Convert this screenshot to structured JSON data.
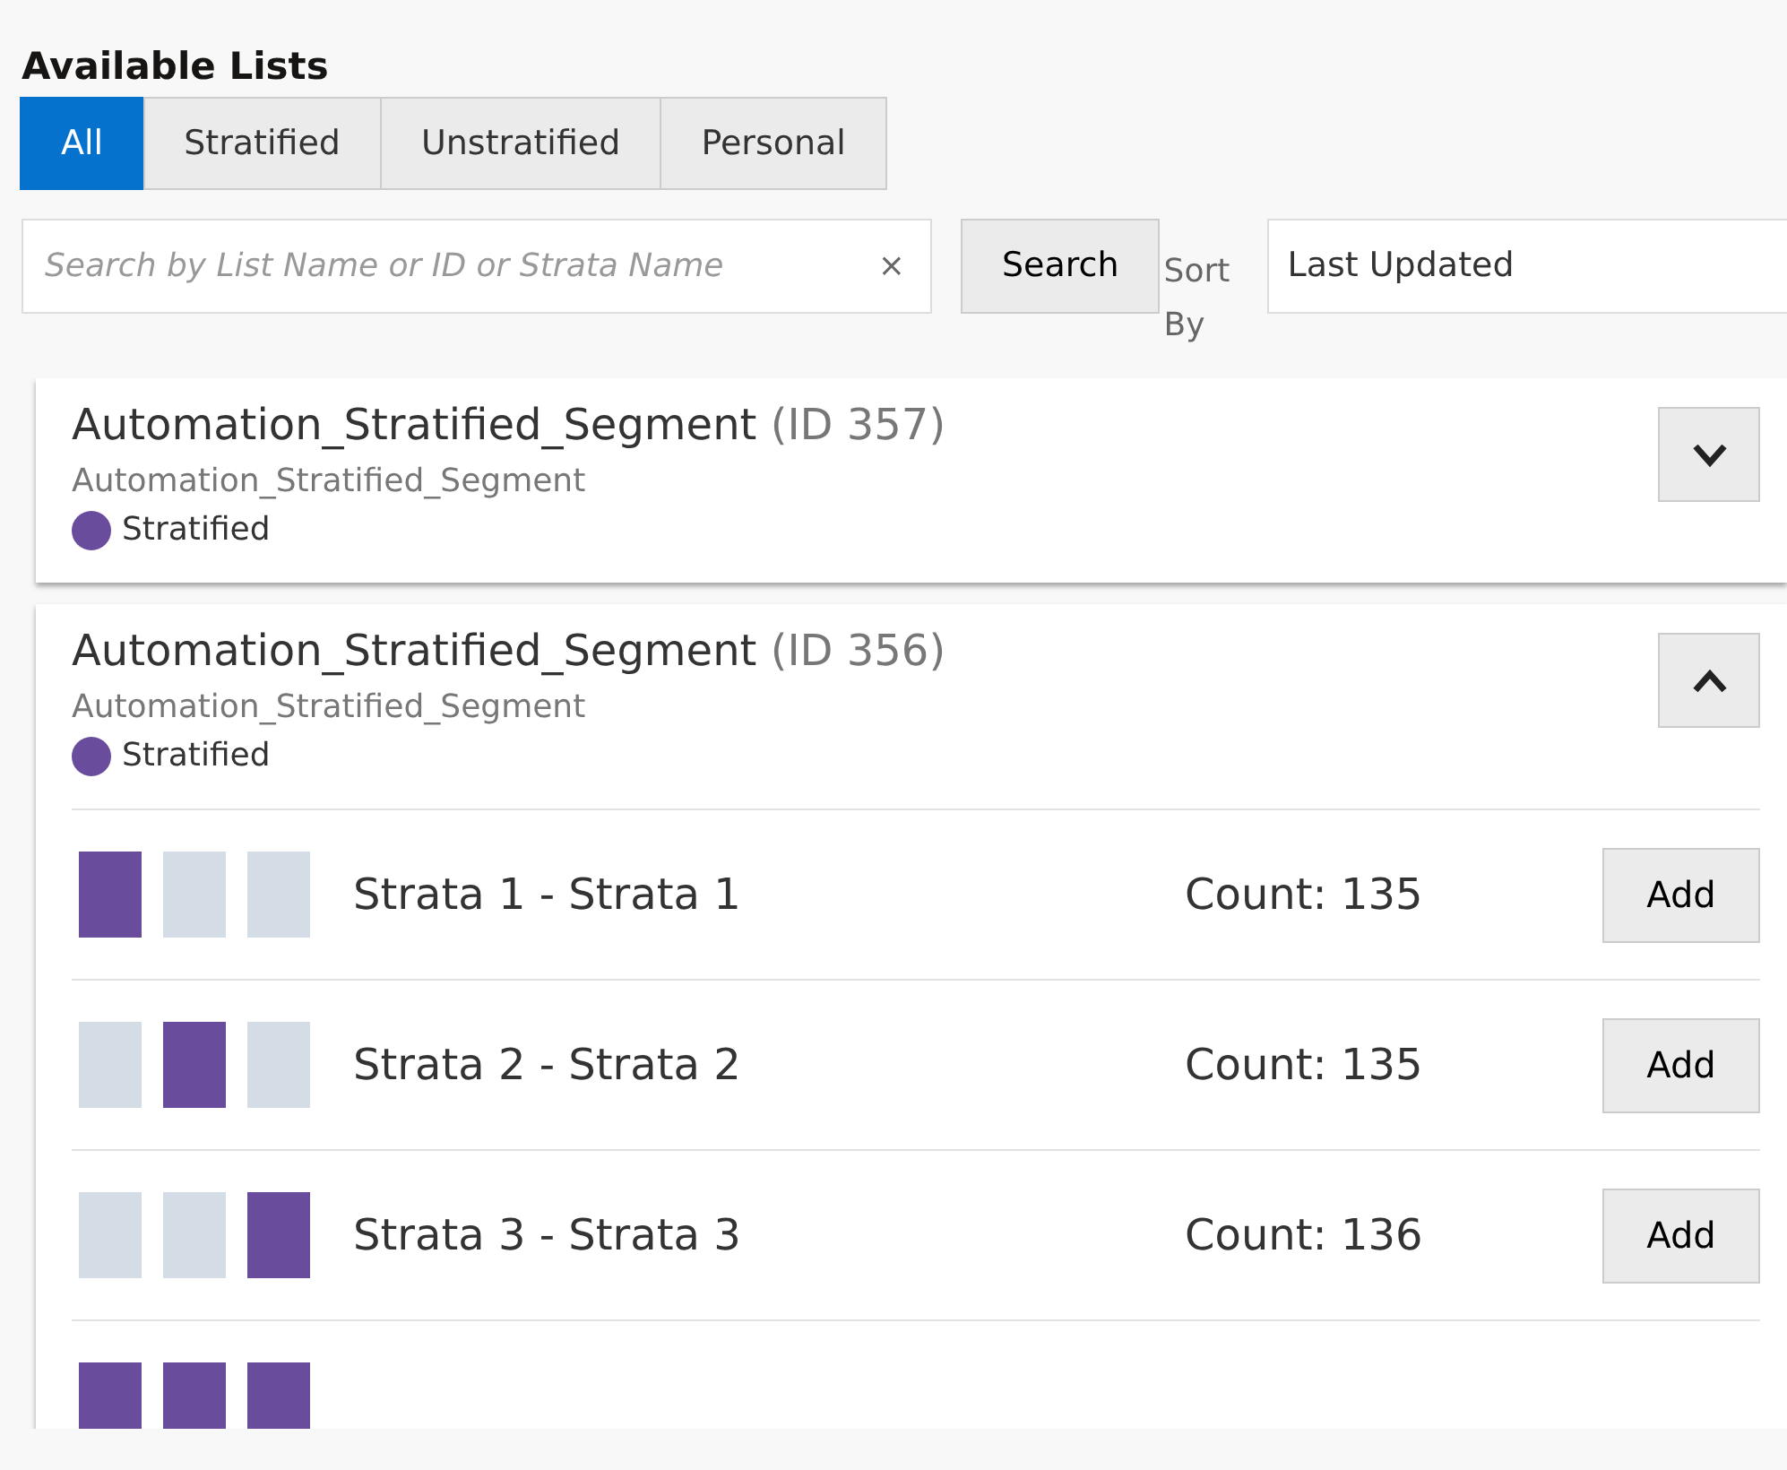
{
  "title": "Available Lists",
  "tabs": [
    {
      "label": "All",
      "selected": true
    },
    {
      "label": "Stratified",
      "selected": false
    },
    {
      "label": "Unstratified",
      "selected": false
    },
    {
      "label": "Personal",
      "selected": false
    }
  ],
  "search": {
    "placeholder": "Search by List Name or ID or Strata Name",
    "clear": "×",
    "button": "Search"
  },
  "sort": {
    "label": "Sort By",
    "value": "Last Updated"
  },
  "lists": [
    {
      "name": "Automation_Stratified_Segment",
      "id": "(ID 357)",
      "subtitle": "Automation_Stratified_Segment",
      "type": "Stratified",
      "color": "#6a4c9c",
      "expanded": false
    },
    {
      "name": "Automation_Stratified_Segment",
      "id": "(ID 356)",
      "subtitle": "Automation_Stratified_Segment",
      "type": "Stratified",
      "color": "#6a4c9c",
      "expanded": true,
      "strata": [
        {
          "label": "Strata 1 - Strata 1",
          "count": "Count: 135",
          "button": "Add",
          "segments": [
            {
              "on": true
            },
            {
              "on": false
            },
            {
              "on": false
            }
          ]
        },
        {
          "label": "Strata 2 - Strata 2",
          "count": "Count: 135",
          "button": "Add",
          "segments": [
            {
              "on": false
            },
            {
              "on": true
            },
            {
              "on": false
            }
          ]
        },
        {
          "label": "Strata 3 - Strata 3",
          "count": "Count: 136",
          "button": "Add",
          "segments": [
            {
              "on": false
            },
            {
              "on": false
            },
            {
              "on": true
            }
          ]
        },
        {
          "segments": [
            {
              "on": true
            },
            {
              "on": true
            },
            {
              "on": true
            }
          ]
        }
      ]
    }
  ]
}
